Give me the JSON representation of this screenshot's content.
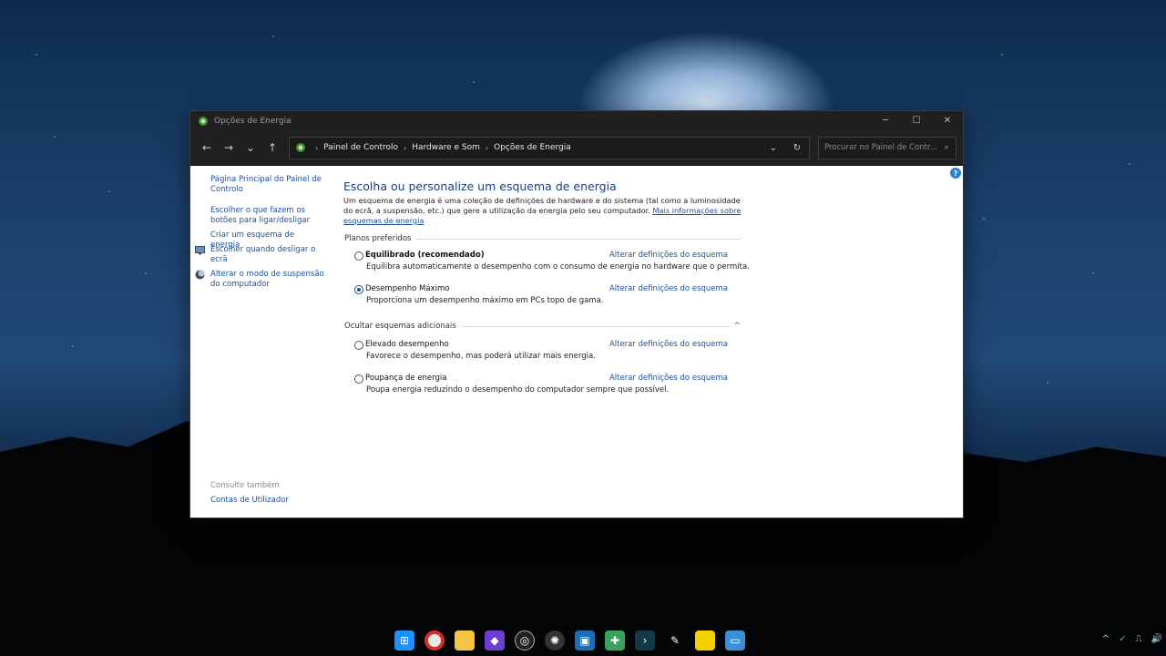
{
  "window": {
    "title": "Opções de Energia",
    "minimize": "─",
    "maximize": "☐",
    "close": "✕"
  },
  "nav": {
    "back": "←",
    "forward": "→",
    "recent": "⌄",
    "up": "↑"
  },
  "address": {
    "crumbs": [
      "Painel de Controlo",
      "Hardware e Som",
      "Opções de Energia"
    ],
    "sep": "›",
    "dropdown": "⌄",
    "refresh": "↻"
  },
  "search": {
    "placeholder": "Procurar no Painel de Contr...",
    "icon": "⌕"
  },
  "help": "?",
  "sidebar": {
    "links": [
      "Página Principal do Painel de Controlo",
      "Escolher o que fazem os botões para ligar/desligar",
      "Criar um esquema de energia",
      "Escolher quando desligar o ecrã",
      "Alterar o modo de suspensão do computador"
    ],
    "see_also": "Consulte também",
    "user_accounts": "Contas de Utilizador"
  },
  "main": {
    "heading": "Escolha ou personalize um esquema de energia",
    "description": "Um esquema de energia é uma coleção de definições de hardware e do sistema (tal como a luminosidade do ecrã, a suspensão, etc.) que gere a utilização da energia pelo seu computador.",
    "more_info": "Mais informações sobre esquemas de energia",
    "preferred_label": "Planos preferidos",
    "hidden_label": "Ocultar esquemas adicionais",
    "hidden_chevron": "^",
    "change_link": "Alterar definições do esquema",
    "plans": [
      {
        "name": "Equilibrado (recomendado)",
        "desc": "Equilibra automaticamente o desempenho com o consumo de energia no hardware que o permita.",
        "selected": false
      },
      {
        "name": "Desempenho Máximo",
        "desc": "Proporciona um desempenho máximo em PCs topo de gama.",
        "selected": true
      },
      {
        "name": "Elevado desempenho",
        "desc": "Favorece o desempenho, mas poderá utilizar mais energia.",
        "selected": false
      },
      {
        "name": "Poupança de energia",
        "desc": "Poupa energia reduzindo o desempenho do computador sempre que possível.",
        "selected": false
      }
    ]
  },
  "taskbar": {
    "icons": [
      "start-icon",
      "chrome-icon",
      "file-explorer-icon",
      "app-icon",
      "obs-icon",
      "davinci-icon",
      "virtualbox-icon",
      "app2-icon",
      "terminal-icon",
      "pen-icon",
      "sticky-notes-icon",
      "remote-desktop-icon"
    ],
    "tray": [
      "^",
      "✓",
      "⎍",
      "🔊"
    ]
  }
}
